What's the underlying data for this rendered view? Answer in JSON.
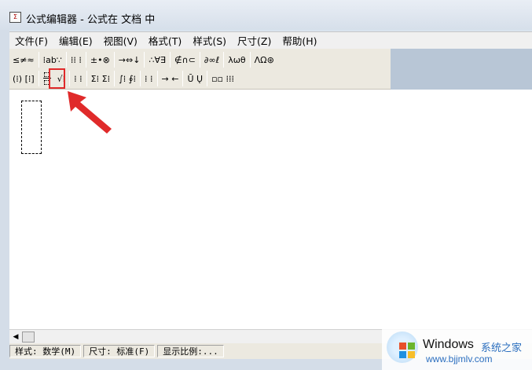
{
  "window": {
    "title": "公式编辑器 - 公式在 文档 中",
    "icon_text": "Σ"
  },
  "menu": [
    "文件(F)",
    "编辑(E)",
    "视图(V)",
    "格式(T)",
    "样式(S)",
    "尺寸(Z)",
    "帮助(H)"
  ],
  "toolbar": {
    "row1": [
      "≤≠≈",
      "⁞ab∵",
      "⁞⁞ ⁞",
      "±•⊗",
      "→⇔↓",
      "∴∀∃",
      "∉∩⊂",
      "∂∞ℓ",
      "λωθ",
      "ΛΩ⊛"
    ],
    "row2": [
      "(⁞) [⁞]",
      "fraction",
      "√⁞",
      "⁞ ⁞",
      "Σ⁞ Σ⁞",
      "∫⁞ ∮⁞",
      "⁞ ⁞",
      "→ ←",
      "Ū Ų",
      "▫▫ ⁞⁞⁞"
    ]
  },
  "status": {
    "style": "样式: 数学(M)",
    "size": "尺寸: 标准(F)",
    "zoom": "显示比例:..."
  },
  "watermark": {
    "brand": "Windows",
    "cn": "系统之家",
    "url": "www.bjjmlv.com"
  },
  "colors": {
    "highlight": "#e02a2a",
    "arrow": "#e02a2a"
  }
}
